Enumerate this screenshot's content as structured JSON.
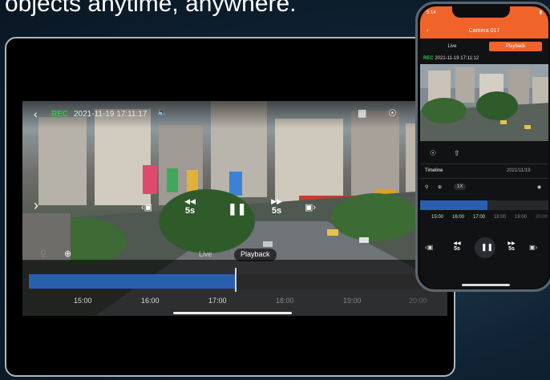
{
  "headline": "objects anytime, anywhere.",
  "tablet": {
    "rec_badge": "REC",
    "timestamp": "2021-11-19 17:11:17",
    "skip_back_label": "5s",
    "skip_fwd_label": "5s",
    "mode_live": "Live",
    "mode_playback": "Playback",
    "timeline_ticks": [
      "15:00",
      "16:00",
      "17:00",
      "18:00",
      "19:00",
      "20:00"
    ]
  },
  "phone": {
    "status_time": "5:14",
    "title": "Camera 017",
    "tab_live": "Live",
    "tab_playback": "Playback",
    "rec_badge": "REC",
    "timestamp": "2021-11-19 17:11:12",
    "timeline_label": "Timeline",
    "timeline_date": "2021/11/19",
    "speed": "1X",
    "timeline_ticks": [
      "15:00",
      "16:00",
      "17:00",
      "18:00",
      "19:00",
      "20:00"
    ],
    "skip_back_label": "5s",
    "skip_fwd_label": "5s"
  },
  "colors": {
    "accent": "#f0642a",
    "timeline_fill": "#2a5fb0",
    "rec_green": "#2ecc40"
  }
}
